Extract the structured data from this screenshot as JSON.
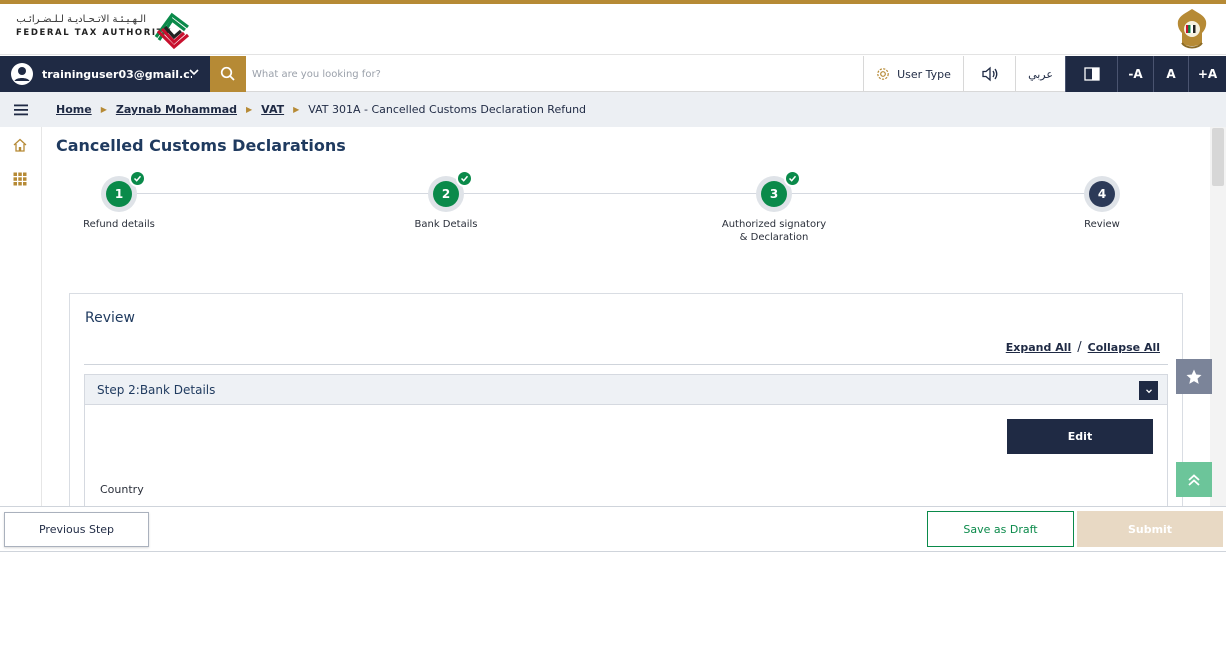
{
  "header": {
    "logo_arabic": "الـهـيـئـة الاتـحـاديـة لـلـضـرائـب",
    "logo_english": "FEDERAL TAX AUTHORITY"
  },
  "toolbar": {
    "user_email": "traininguser03@gmail.c...",
    "search_placeholder": "What are you looking for?",
    "user_type_label": "User Type",
    "language_label": "عربي",
    "font_decrease": "-A",
    "font_normal": "A",
    "font_increase": "+A"
  },
  "breadcrumb": {
    "home": "Home",
    "user": "Zaynab Mohammad",
    "section": "VAT",
    "current": "VAT 301A - Cancelled Customs Declaration Refund"
  },
  "page": {
    "title": "Cancelled Customs Declarations"
  },
  "steps": [
    {
      "number": "1",
      "label": "Refund details",
      "completed": true
    },
    {
      "number": "2",
      "label": "Bank Details",
      "completed": true
    },
    {
      "number": "3",
      "label": "Authorized signatory\n& Declaration",
      "completed": true
    },
    {
      "number": "4",
      "label": "Review",
      "completed": false
    }
  ],
  "review": {
    "title": "Review",
    "expand_all": "Expand All",
    "separator": "/",
    "collapse_all": "Collapse All",
    "section_title": "Step 2:Bank Details",
    "edit_label": "Edit",
    "field_country": "Country"
  },
  "footer": {
    "previous_label": "Previous Step",
    "draft_label": "Save as Draft",
    "submit_label": "Submit"
  },
  "colors": {
    "navy": "#1f2a44",
    "gold": "#b68a35",
    "green": "#0a8a4a",
    "submit_disabled": "#e8d9c4"
  }
}
